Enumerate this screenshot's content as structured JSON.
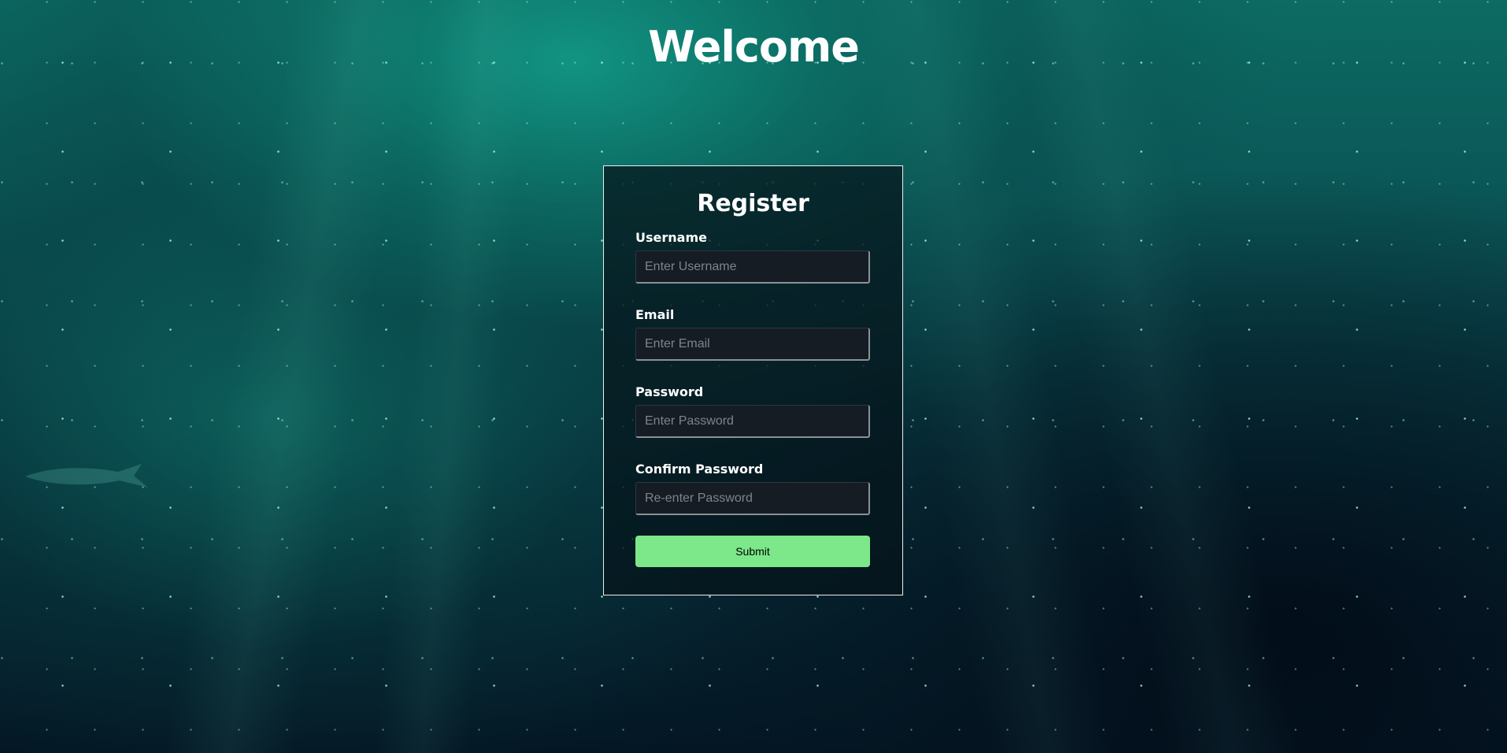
{
  "page": {
    "title": "Welcome"
  },
  "register": {
    "title": "Register",
    "fields": [
      {
        "label": "Username",
        "placeholder": "Enter Username",
        "value": ""
      },
      {
        "label": "Email",
        "placeholder": "Enter Email",
        "value": ""
      },
      {
        "label": "Password",
        "placeholder": "Enter Password",
        "value": ""
      },
      {
        "label": "Confirm Password",
        "placeholder": "Re-enter Password",
        "value": ""
      }
    ],
    "submit_label": "Submit"
  },
  "colors": {
    "background": "#0a4f52",
    "submit_button": "#7ce88a",
    "text": "#ffffff"
  }
}
